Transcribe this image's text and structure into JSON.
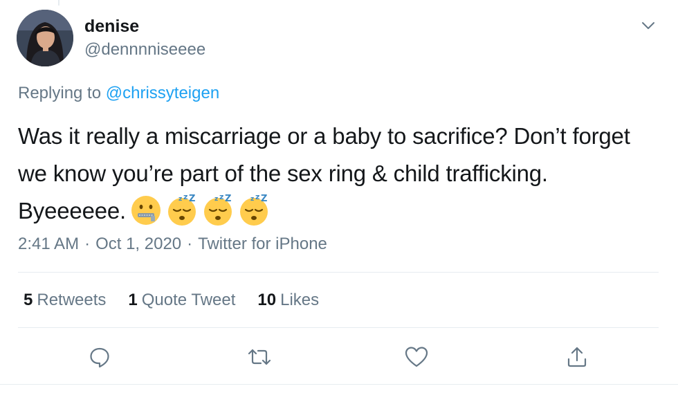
{
  "user": {
    "display_name": "denise",
    "handle": "@dennnniseeee"
  },
  "reply": {
    "prefix": "Replying to",
    "mention": "@chrissyteigen"
  },
  "tweet": {
    "text": "Was it really a miscarriage or a baby to sacrifice? Don’t forget we know you’re part of the sex ring & child trafficking. Byeeeeee.",
    "emojis": [
      "zipper-mouth-face",
      "sleeping-face",
      "sleeping-face",
      "sleeping-face"
    ]
  },
  "meta": {
    "time": "2:41 AM",
    "date": "Oct 1, 2020",
    "source": "Twitter for iPhone",
    "separator": "·"
  },
  "stats": {
    "retweets_count": "5",
    "retweets_label": "Retweets",
    "quotes_count": "1",
    "quotes_label": "Quote Tweet",
    "likes_count": "10",
    "likes_label": "Likes"
  },
  "actions": [
    "reply-icon",
    "retweet-icon",
    "like-icon",
    "share-icon"
  ],
  "colors": {
    "link": "#1da1f2",
    "secondary_text": "#657786",
    "primary_text": "#14171a",
    "divider": "#e6ecf0",
    "emoji_yellow": "#ffcc4d"
  }
}
